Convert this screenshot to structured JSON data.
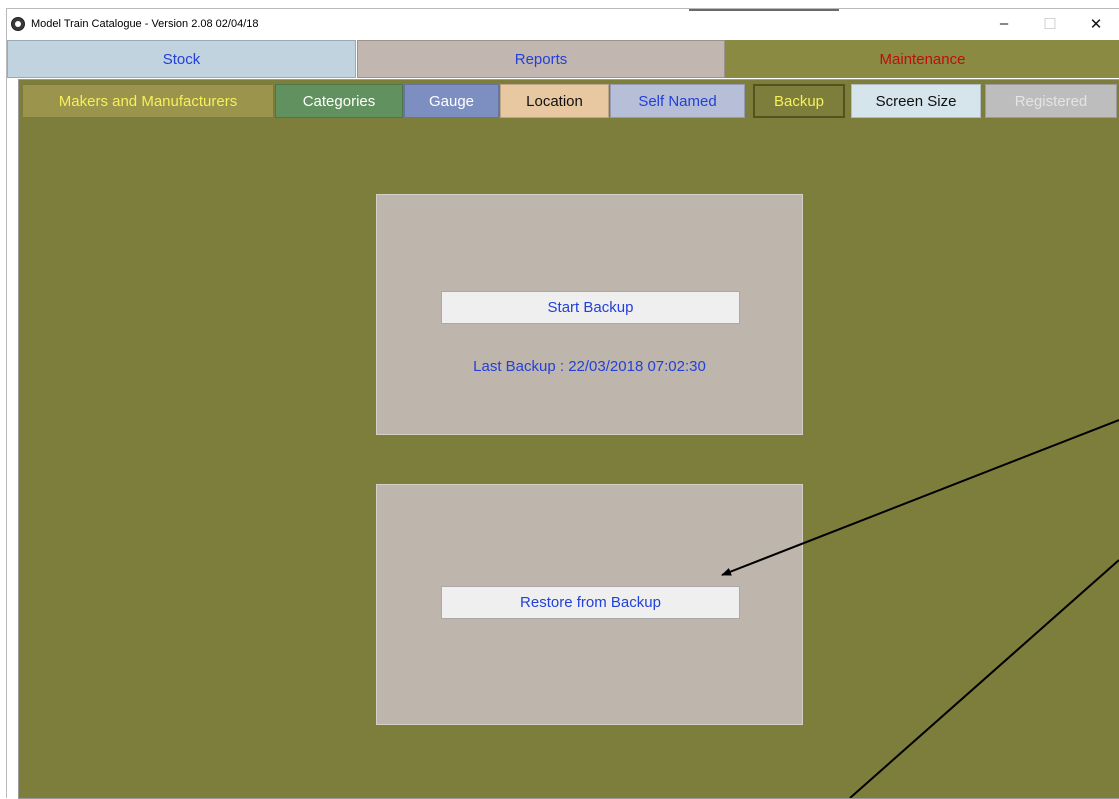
{
  "window": {
    "title": "Model Train Catalogue -  Version 2.08  02/04/18",
    "minimize": "–",
    "maximize": "☐",
    "close": "✕"
  },
  "main_tabs": [
    {
      "label": "Stock"
    },
    {
      "label": "Reports"
    },
    {
      "label": "Maintenance",
      "selected": true
    }
  ],
  "sub_tabs": [
    {
      "label": "Makers and Manufacturers"
    },
    {
      "label": "Categories"
    },
    {
      "label": "Gauge"
    },
    {
      "label": "Location"
    },
    {
      "label": "Self Named"
    },
    {
      "label": "Backup",
      "selected": true
    },
    {
      "label": "Screen Size"
    },
    {
      "label": "Registered",
      "disabled": true
    }
  ],
  "backup": {
    "start_label": "Start Backup",
    "last_backup": "Last Backup : 22/03/2018 07:02:30"
  },
  "restore": {
    "restore_label": "Restore from Backup"
  },
  "colors": {
    "panel": "#7d7e3c",
    "card": "#beb5ad",
    "link_blue": "#2340d8",
    "maintenance_red": "#c00d0d"
  }
}
